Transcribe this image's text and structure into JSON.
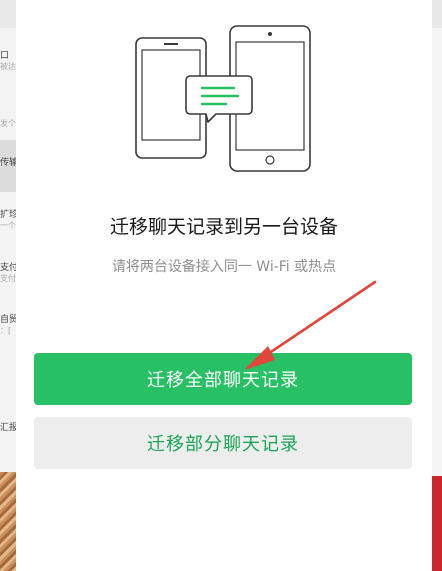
{
  "background_app": {
    "rows": [
      {
        "label": "口",
        "sub": "被达"
      },
      {
        "label": "",
        "sub": "发个"
      },
      {
        "label": "传输",
        "sub": ""
      },
      {
        "label": "扩珍",
        "sub": "一个"
      },
      {
        "label": "支付",
        "sub": "支付"
      },
      {
        "label": "自贸",
        "sub": "：["
      },
      {
        "label": "汇报",
        "sub": ""
      }
    ]
  },
  "dialog": {
    "title": "迁移聊天记录到另一台设备",
    "subtitle": "请将两台设备接入同一 Wi-Fi 或热点",
    "migrate_all_label": "迁移全部聊天记录",
    "migrate_partial_label": "迁移部分聊天记录"
  },
  "illustration": {
    "icons": [
      "phone-left-icon",
      "phone-right-icon",
      "chat-bubble-icon"
    ]
  },
  "colors": {
    "accent": "#27c065",
    "secondary_text": "#1aa454",
    "arrow": "#e2463b"
  }
}
